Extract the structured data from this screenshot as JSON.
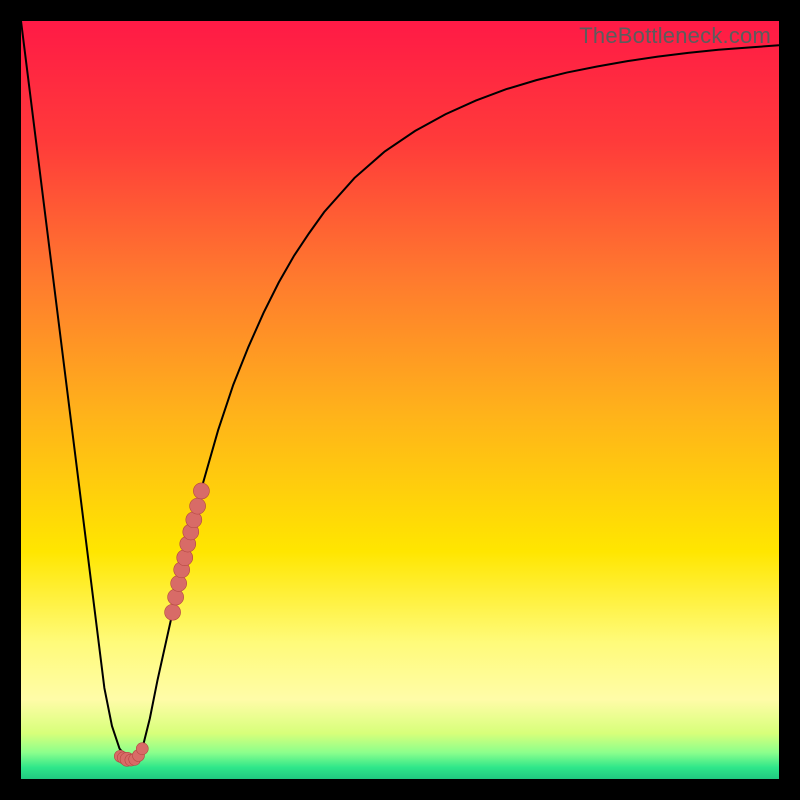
{
  "watermark": "TheBottleneck.com",
  "colors": {
    "frame": "#000000",
    "curve": "#000000",
    "marker_fill": "#d86b67",
    "marker_stroke": "#b34642"
  },
  "chart_data": {
    "type": "line",
    "title": "",
    "xlabel": "",
    "ylabel": "",
    "xlim": [
      0,
      100
    ],
    "ylim": [
      0,
      100
    ],
    "gradient_stops": [
      {
        "pos": 0.0,
        "color": "#ff1a46"
      },
      {
        "pos": 0.16,
        "color": "#ff3b3a"
      },
      {
        "pos": 0.34,
        "color": "#ff7a2e"
      },
      {
        "pos": 0.52,
        "color": "#ffb31a"
      },
      {
        "pos": 0.7,
        "color": "#ffe600"
      },
      {
        "pos": 0.82,
        "color": "#fffb7a"
      },
      {
        "pos": 0.895,
        "color": "#fffca8"
      },
      {
        "pos": 0.94,
        "color": "#d7ff7a"
      },
      {
        "pos": 0.965,
        "color": "#8cff8c"
      },
      {
        "pos": 0.985,
        "color": "#2ee68a"
      },
      {
        "pos": 1.0,
        "color": "#20c980"
      }
    ],
    "series": [
      {
        "name": "bottleneck-curve",
        "x": [
          0,
          1,
          2,
          3,
          4,
          5,
          6,
          7,
          8,
          9,
          10,
          11,
          12,
          13,
          14,
          15,
          16,
          17,
          18,
          20,
          22,
          24,
          26,
          28,
          30,
          32,
          34,
          36,
          38,
          40,
          44,
          48,
          52,
          56,
          60,
          64,
          68,
          72,
          76,
          80,
          84,
          88,
          92,
          96,
          100
        ],
        "y": [
          100,
          92,
          84,
          76,
          68,
          60,
          52,
          44,
          36,
          28,
          20,
          12,
          7,
          4,
          2.8,
          2.5,
          4,
          8,
          13,
          22,
          31,
          39,
          46,
          52,
          57,
          61.5,
          65.5,
          69,
          72,
          74.8,
          79.3,
          82.8,
          85.5,
          87.7,
          89.5,
          91,
          92.2,
          93.2,
          94,
          94.7,
          95.3,
          95.8,
          96.2,
          96.5,
          96.8
        ]
      }
    ],
    "markers": [
      {
        "x": 13.1,
        "y": 3.0,
        "r": 6
      },
      {
        "x": 13.5,
        "y": 2.8,
        "r": 6
      },
      {
        "x": 14.0,
        "y": 2.6,
        "r": 7
      },
      {
        "x": 14.5,
        "y": 2.5,
        "r": 6
      },
      {
        "x": 15.0,
        "y": 2.6,
        "r": 6
      },
      {
        "x": 15.5,
        "y": 3.1,
        "r": 6
      },
      {
        "x": 16.0,
        "y": 4.0,
        "r": 6
      },
      {
        "x": 20.0,
        "y": 22.0,
        "r": 8
      },
      {
        "x": 20.4,
        "y": 24.0,
        "r": 8
      },
      {
        "x": 20.8,
        "y": 25.8,
        "r": 8
      },
      {
        "x": 21.2,
        "y": 27.6,
        "r": 8
      },
      {
        "x": 21.6,
        "y": 29.2,
        "r": 8
      },
      {
        "x": 22.0,
        "y": 31.0,
        "r": 8
      },
      {
        "x": 22.4,
        "y": 32.6,
        "r": 8
      },
      {
        "x": 22.8,
        "y": 34.2,
        "r": 8
      },
      {
        "x": 23.3,
        "y": 36.0,
        "r": 8
      },
      {
        "x": 23.8,
        "y": 38.0,
        "r": 8
      }
    ]
  }
}
